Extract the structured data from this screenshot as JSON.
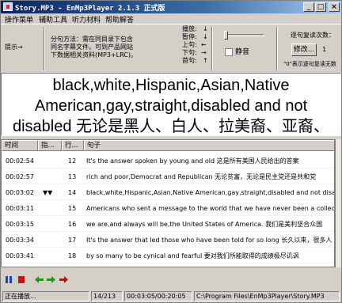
{
  "window": {
    "title": "Story.MP3 - EnMp3Player 2.1.3 正式版"
  },
  "menu": [
    "操作菜单",
    "辅助工具",
    "听力材料",
    "帮助解答"
  ],
  "panel": {
    "hint_label": "提示→",
    "split_desc_lines": [
      "分句方法：需在同目录下包含",
      "同名字幕文件。可到产品网站",
      "下数据相关资料(MP3+LRC)。"
    ],
    "keys": [
      "播放:",
      "暂停:",
      "上句:",
      "下句:",
      "首句:"
    ],
    "key_arrows": [
      "↓",
      "↓",
      "←",
      "→",
      "↑"
    ],
    "mute_label": "静音",
    "repeat_label": "逐句复读次数：",
    "modify_button": "修改...",
    "repeat_count": "1",
    "repeat_note": "\"0\"表示逐句复读无数"
  },
  "lyric": {
    "lines": [
      "black,white,Hispanic,Asian,Native",
      "American,gay,straight,disabled and not",
      "disabled 无论是黑人、白人、拉美裔、亚裔、"
    ]
  },
  "table": {
    "columns": [
      "时间",
      "指...",
      "行...",
      "句子"
    ],
    "rows": [
      {
        "time": "00:02:54",
        "mark": "",
        "line": "12",
        "text": "It's the answer spoken by young and old 这是所有美国人民给出的答案"
      },
      {
        "time": "00:02:57",
        "mark": "",
        "line": "13",
        "text": "rich and poor,Democrat and Republican 无论贫富，无论是民主党还是共和党"
      },
      {
        "time": "00:03:02",
        "mark": "▼▼",
        "line": "14",
        "text": "black,white,Hispanic,Asian,Native American,gay,straight,disabled and not disabled"
      },
      {
        "time": "00:03:11",
        "mark": "",
        "line": "15",
        "text": "Americans who sent a message to the world that we have never been a collection"
      },
      {
        "time": "00:03:15",
        "mark": "",
        "line": "16",
        "text": "we are,and always will be,the United States of America. 我们是美利坚合众国"
      },
      {
        "time": "00:03:34",
        "mark": "",
        "line": "17",
        "text": "It's the answer that led those who have been told for so long 长久以来，很多人"
      },
      {
        "time": "00:03:41",
        "mark": "",
        "line": "18",
        "text": "by so many to be cynical and fearful 要对我们所能取得的成绩极尽讥讽"
      }
    ]
  },
  "status": {
    "state": "正在播放...",
    "sentence_pos": "14/213",
    "time_pos": "00:03:05/00:20:05",
    "file_path": "C:\\Program Files\\EnMp3Player\\Story.MP3"
  }
}
